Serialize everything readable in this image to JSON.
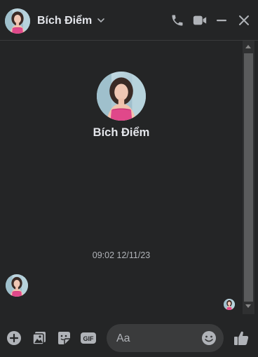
{
  "header": {
    "contact_name": "Bích Điểm",
    "icons": [
      "chevron-down-icon",
      "phone-icon",
      "video-icon",
      "minimize-icon",
      "close-icon"
    ]
  },
  "conversation": {
    "contact_name": "Bích Điểm",
    "timestamp": "09:02 12/11/23"
  },
  "composer": {
    "placeholder": "Aa",
    "icons": [
      "plus-icon",
      "photo-icon",
      "sticker-icon",
      "gif-icon",
      "emoji-icon",
      "thumbs-up-icon"
    ]
  },
  "colors": {
    "background": "#242526",
    "text": "#e4e6eb",
    "muted": "#b0b3b8",
    "icon": "#b0b3b8",
    "input_bg": "#3a3b3c"
  }
}
